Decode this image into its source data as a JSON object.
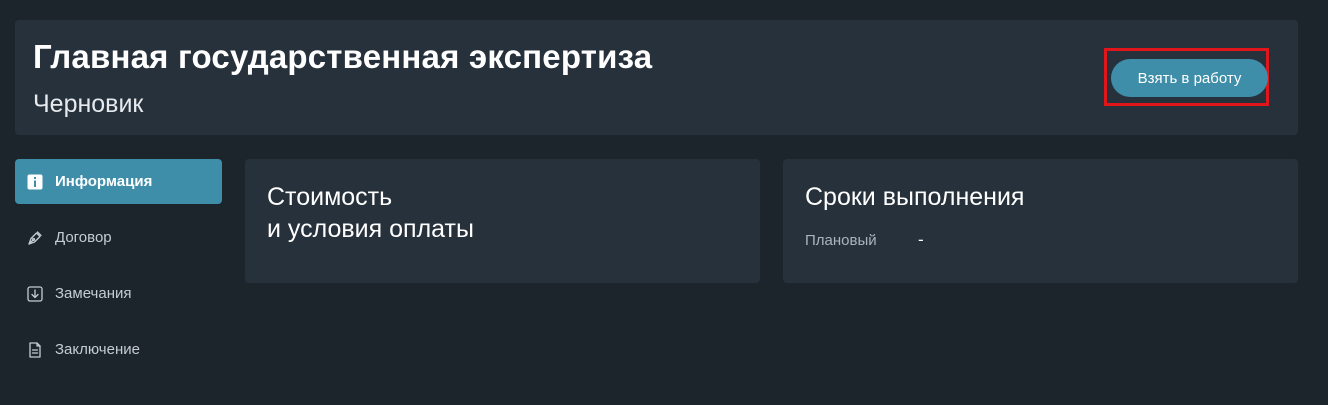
{
  "header": {
    "title": "Главная государственная экспертиза",
    "subtitle": "Черновик",
    "action_label": "Взять в работу"
  },
  "sidebar": {
    "items": [
      {
        "label": "Информация",
        "icon": "info-icon",
        "active": true
      },
      {
        "label": "Договор",
        "icon": "pen-icon",
        "active": false
      },
      {
        "label": "Замечания",
        "icon": "download-box-icon",
        "active": false
      },
      {
        "label": "Заключение",
        "icon": "document-icon",
        "active": false
      }
    ]
  },
  "cards": {
    "payment": {
      "title_line1": "Стоимость",
      "title_line2": "и условия оплаты"
    },
    "deadlines": {
      "title": "Сроки выполнения",
      "planned_label": "Плановый",
      "planned_value": "-"
    }
  },
  "colors": {
    "background": "#1d252c",
    "panel": "#27313b",
    "accent": "#3e8ea9",
    "highlight": "#e0161a"
  }
}
